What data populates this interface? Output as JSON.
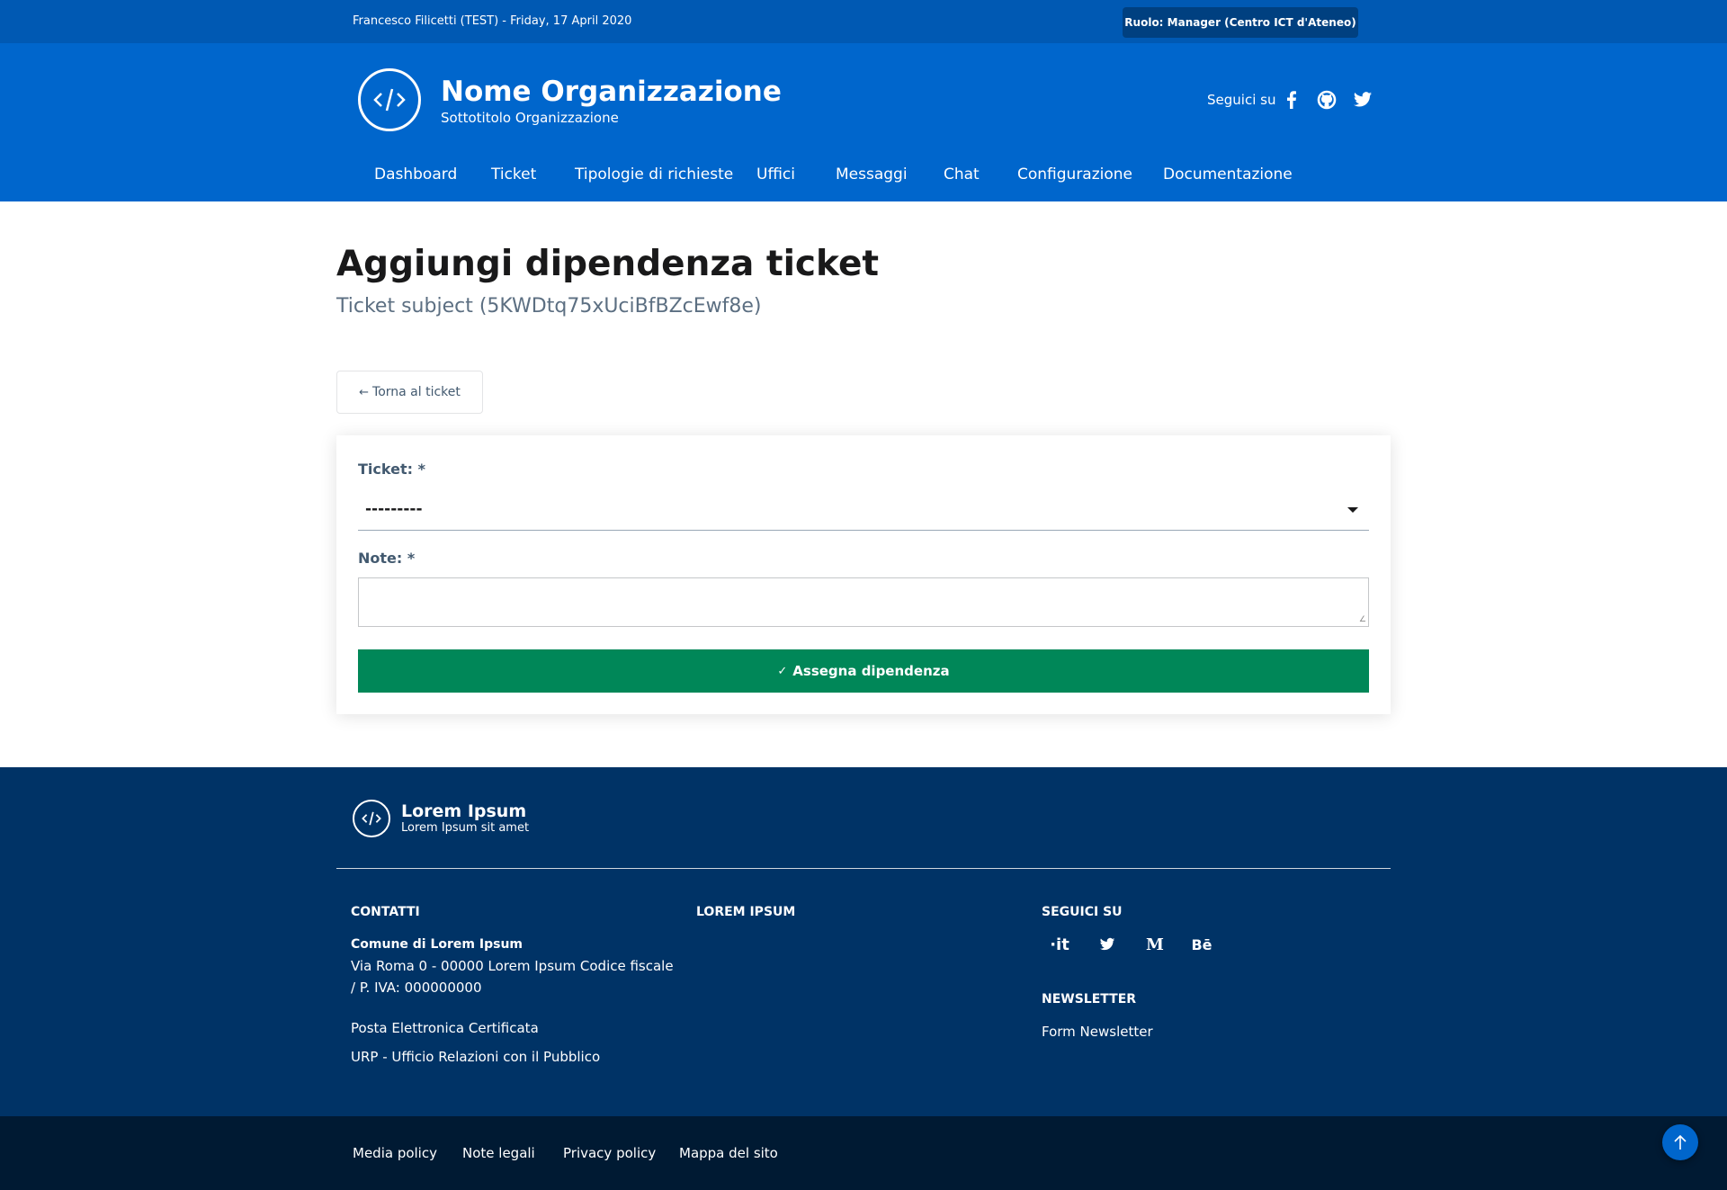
{
  "slim_header": {
    "user_info": "Francesco Filicetti (TEST) - Friday, 17 April 2020",
    "role_button": "Ruolo: Manager (Centro ICT d'Ateneo)"
  },
  "brand": {
    "title": "Nome Organizzazione",
    "subtitle": "Sottotitolo Organizzazione",
    "logo_icon": "code-icon"
  },
  "social": {
    "label": "Seguici su",
    "icons": [
      "facebook-icon",
      "github-icon",
      "twitter-icon"
    ]
  },
  "nav": {
    "items": [
      "Dashboard",
      "Ticket",
      "Tipologie di richieste",
      "Uffici",
      "Messaggi",
      "Chat",
      "Configurazione",
      "Documentazione"
    ]
  },
  "page": {
    "title": "Aggiungi dipendenza ticket",
    "subtitle": "Ticket subject (5KWDtq75xUciBfBZcEwf8e)"
  },
  "back_button": {
    "label": "Torna al ticket",
    "icon": "arrow-left-icon"
  },
  "form": {
    "ticket_label": "Ticket: *",
    "ticket_value": "---------",
    "note_label": "Note: *",
    "note_value": "",
    "submit_label": "Assegna dipendenza",
    "submit_icon": "check-icon"
  },
  "footer": {
    "brand_title": "Lorem Ipsum",
    "brand_subtitle": "Lorem Ipsum sit amet",
    "contacts_heading": "CONTATTI",
    "contacts_name": "Comune di Lorem Ipsum",
    "contacts_address": "Via Roma 0 - 00000 Lorem Ipsum Codice fiscale / P. IVA: 000000000",
    "pec_link": "Posta Elettronica Certificata",
    "urp_link": "URP - Ufficio Relazioni con il Pubblico",
    "lorem_heading": "LOREM IPSUM",
    "follow_heading": "SEGUICI SU",
    "follow_icons": [
      "designers-italia-icon",
      "twitter-icon",
      "medium-icon",
      "behance-icon"
    ],
    "newsletter_heading": "NEWSLETTER",
    "newsletter_link": "Form Newsletter"
  },
  "bottom_links": [
    "Media policy",
    "Note legali",
    "Privacy policy",
    "Mappa del sito"
  ],
  "colors": {
    "primary": "#0066cc",
    "slim_header": "#0059b3",
    "footer": "#003366",
    "bottom_bar": "#001a33",
    "success": "#008758"
  }
}
